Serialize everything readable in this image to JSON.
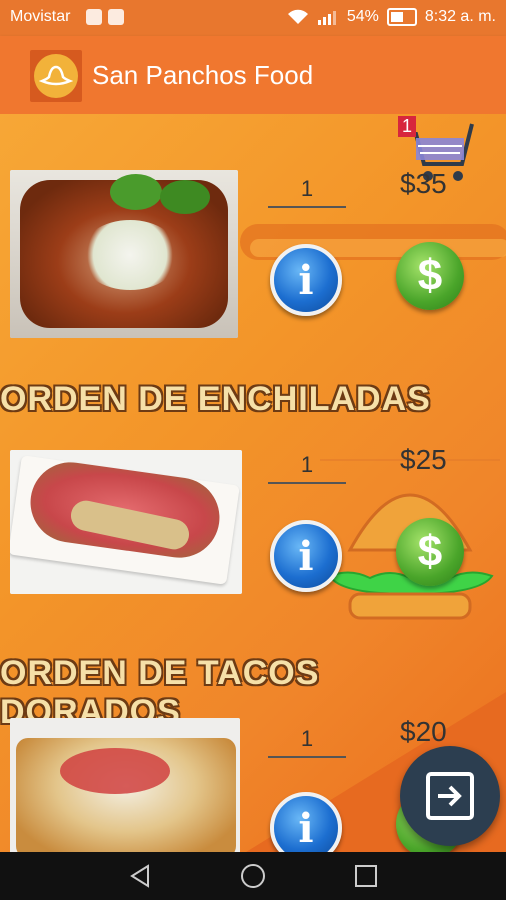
{
  "status_bar": {
    "carrier": "Movistar",
    "battery": "54%",
    "time": "8:32 a. m."
  },
  "app_bar": {
    "title": "San Panchos Food",
    "logo_icon": "sombrero-logo-icon"
  },
  "cart": {
    "count": "1",
    "icon": "shopping-cart-icon"
  },
  "items": [
    {
      "name": "",
      "quantity": "1",
      "price": "$35",
      "image": "enchiladas-plate-image"
    },
    {
      "name": "ORDEN DE ENCHILADAS",
      "quantity": "1",
      "price": "$25",
      "image": "tacos-dorados-tray-image"
    },
    {
      "name": "ORDEN DE TACOS DORADOS",
      "quantity": "1",
      "price": "$20",
      "image": "tostadas-plate-image"
    }
  ],
  "buttons": {
    "info_label": "i",
    "buy_label": "$"
  },
  "colors": {
    "app_bar": "#f0772f",
    "background": "#f39a2a",
    "title_text": "#f6e0a8",
    "fab": "#2c3e50"
  }
}
